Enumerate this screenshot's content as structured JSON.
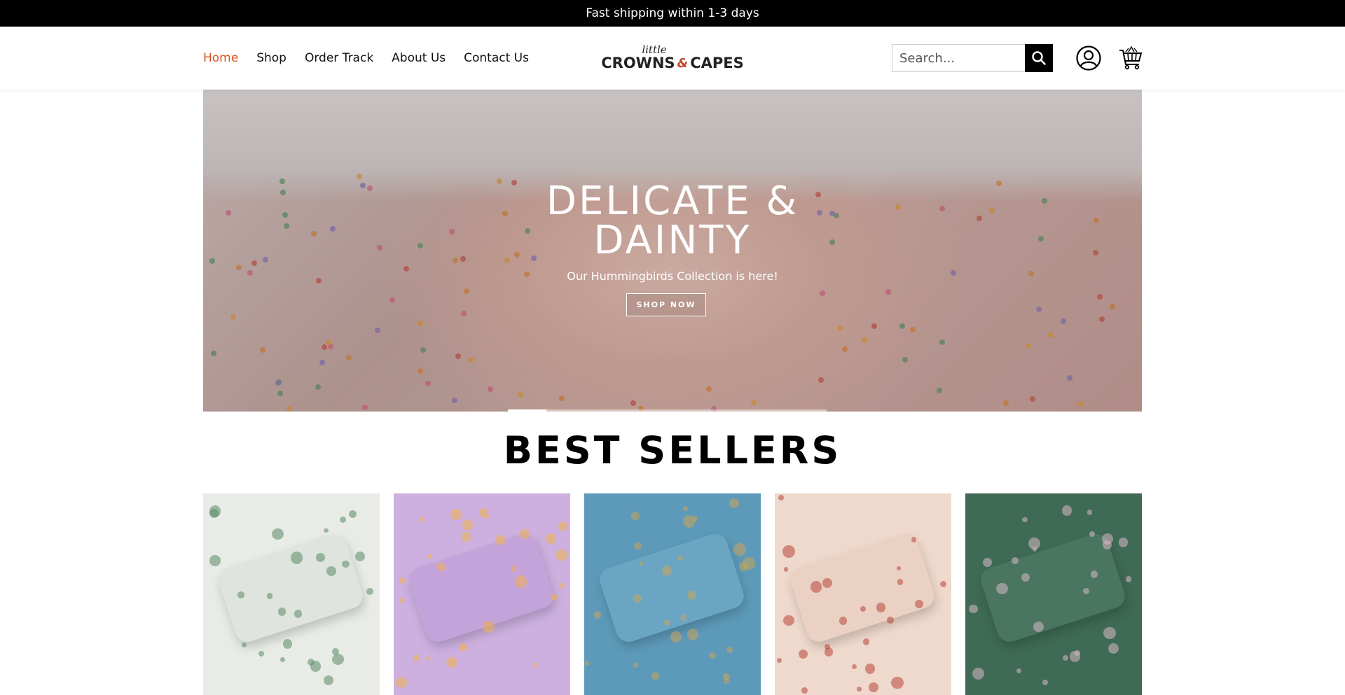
{
  "announcement": {
    "text": "Fast shipping within 1-3 days"
  },
  "nav": {
    "items": [
      {
        "label": "Home",
        "active": true
      },
      {
        "label": "Shop",
        "active": false
      },
      {
        "label": "Order Track",
        "active": false
      },
      {
        "label": "About Us",
        "active": false
      },
      {
        "label": "Contact Us",
        "active": false
      }
    ]
  },
  "logo": {
    "script": "little",
    "word1": "CROWNS",
    "amp": "&",
    "word2": "CAPES"
  },
  "search": {
    "placeholder": "Search...",
    "icon": "search-icon"
  },
  "header_icons": {
    "account": "account-icon",
    "cart": "cart-icon"
  },
  "hero": {
    "title": "DELICATE &\nDAINTY",
    "title_line1": "DELICATE &",
    "title_line2": "DAINTY",
    "subtitle": "Our Hummingbirds Collection is here!",
    "button": "SHOP NOW"
  },
  "best_sellers": {
    "title": "BEST SELLERS",
    "products": [
      {
        "name": "map-pattern-bedding",
        "bg": "#e9ece6",
        "pillow": "#dfe5de",
        "accent": "#5b8a66"
      },
      {
        "name": "lavender-fairy-bedding",
        "bg": "#cdb0e0",
        "pillow": "#c4a2da",
        "accent": "#f0b34a"
      },
      {
        "name": "treasure-map-bedding",
        "bg": "#5d9ab9",
        "pillow": "#6aa6c4",
        "accent": "#c9a45a"
      },
      {
        "name": "books-pattern-bedding",
        "bg": "#efd9cc",
        "pillow": "#ead1c3",
        "accent": "#b8463a"
      },
      {
        "name": "forest-castle-bedding",
        "bg": "#3f6a55",
        "pillow": "#4a7560",
        "accent": "#d8b8c8"
      }
    ]
  },
  "colors": {
    "accent": "#d9531e",
    "announcement_bg": "#000000"
  }
}
